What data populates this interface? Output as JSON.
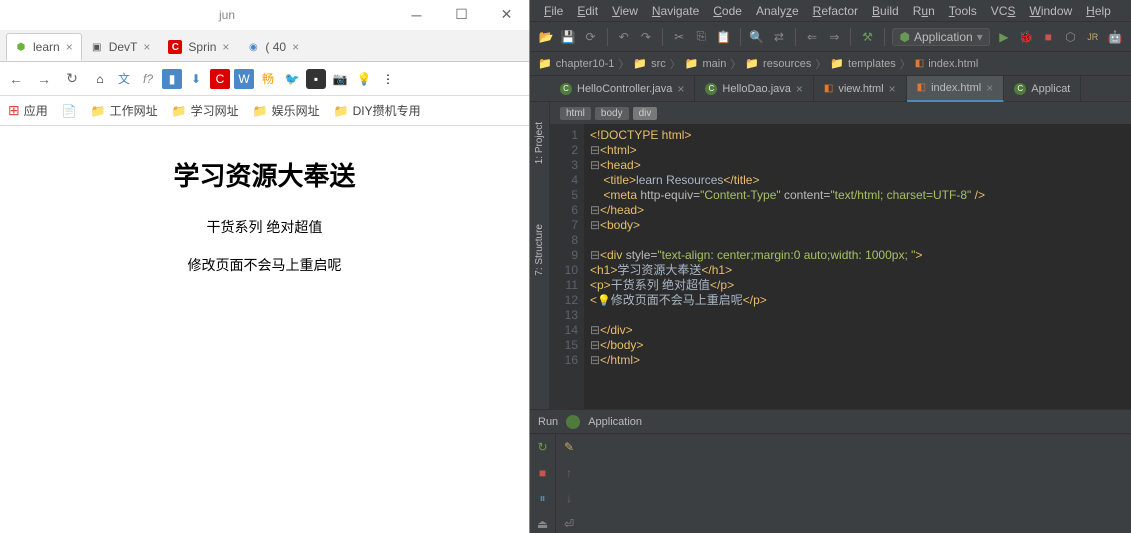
{
  "browser": {
    "window_title": "jun",
    "tabs": [
      {
        "icon": "spring",
        "label": "learn"
      },
      {
        "icon": "devtools",
        "label": "DevT"
      },
      {
        "icon": "c",
        "label": "Sprin"
      },
      {
        "icon": "c2",
        "label": "( 40"
      }
    ],
    "nav": {
      "back": "←",
      "forward": "→",
      "reload": "↻"
    },
    "bookmarks": {
      "apps": "应用",
      "items": [
        "工作网址",
        "学习网址",
        "娱乐网址",
        "DIY攒机专用"
      ]
    },
    "page": {
      "h1": "学习资源大奉送",
      "p1": "干货系列 绝对超值",
      "p2": "修改页面不会马上重启呢"
    }
  },
  "ide": {
    "menu": [
      "File",
      "Edit",
      "View",
      "Navigate",
      "Code",
      "Analyze",
      "Refactor",
      "Build",
      "Run",
      "Tools",
      "VCS",
      "Window",
      "Help"
    ],
    "run_config": "Application",
    "breadcrumbs": [
      "chapter10-1",
      "src",
      "main",
      "resources",
      "templates",
      "index.html"
    ],
    "editor_tabs": [
      {
        "label": "HelloController.java",
        "type": "class"
      },
      {
        "label": "HelloDao.java",
        "type": "class"
      },
      {
        "label": "view.html",
        "type": "html"
      },
      {
        "label": "index.html",
        "type": "html",
        "active": true
      },
      {
        "label": "Applicat",
        "type": "class"
      }
    ],
    "html_crumbs": [
      "html",
      "body",
      "div"
    ],
    "code": {
      "lines": [
        {
          "n": 1,
          "html": "<span class='tag'>&lt;!DOCTYPE html&gt;</span>"
        },
        {
          "n": 2,
          "html": "<span class='fold'>⊟</span><span class='tag'>&lt;html&gt;</span>"
        },
        {
          "n": 3,
          "html": "<span class='fold'>⊟</span><span class='tag'>&lt;head&gt;</span>"
        },
        {
          "n": 4,
          "html": "    <span class='tag'>&lt;title&gt;</span><span class='txt'>learn Resources</span><span class='tag'>&lt;/title&gt;</span>"
        },
        {
          "n": 5,
          "html": "    <span class='tag'>&lt;meta </span><span class='attr'>http-equiv=</span><span class='val'>\"Content-Type\"</span> <span class='attr'>content=</span><span class='val'>\"text/html; charset=UTF-8\"</span> <span class='tag'>/&gt;</span>"
        },
        {
          "n": 6,
          "html": "<span class='fold'>⊟</span><span class='tag'>&lt;/head&gt;</span>"
        },
        {
          "n": 7,
          "html": "<span class='fold'>⊟</span><span class='tag'>&lt;body&gt;</span>"
        },
        {
          "n": 8,
          "html": ""
        },
        {
          "n": 9,
          "html": "<span class='fold'>⊟</span><span class='tag'>&lt;div </span><span class='attr'>style=</span><span class='val'>\"text-align: center;margin:0 auto;width: 1000px; \"</span><span class='tag'>&gt;</span>"
        },
        {
          "n": 10,
          "html": "<span class='tag'>&lt;h1&gt;</span><span class='txt'>学习资源大奉送</span><span class='tag'>&lt;/h1&gt;</span>"
        },
        {
          "n": 11,
          "html": "<span class='tag'>&lt;p&gt;</span><span class='txt'>干货系列 绝对超值</span><span class='tag'>&lt;/p&gt;</span>"
        },
        {
          "n": 12,
          "html": "<span class='tag'>&lt;</span><span class='emoji'>💡</span><span class='txt'>修改页面不会马上重启呢</span><span class='tag'>&lt;/p&gt;</span>"
        },
        {
          "n": 13,
          "html": ""
        },
        {
          "n": 14,
          "html": "<span class='fold'>⊟</span><span class='tag'>&lt;/div&gt;</span>"
        },
        {
          "n": 15,
          "html": "<span class='fold'>⊟</span><span class='tag'>&lt;/body&gt;</span>"
        },
        {
          "n": 16,
          "html": "<span class='fold'>⊟</span><span class='tag'>&lt;/html&gt;</span>"
        }
      ]
    },
    "run_label": "Run",
    "run_app": "Application",
    "side_tabs": [
      "1: Project",
      "7: Structure"
    ]
  }
}
